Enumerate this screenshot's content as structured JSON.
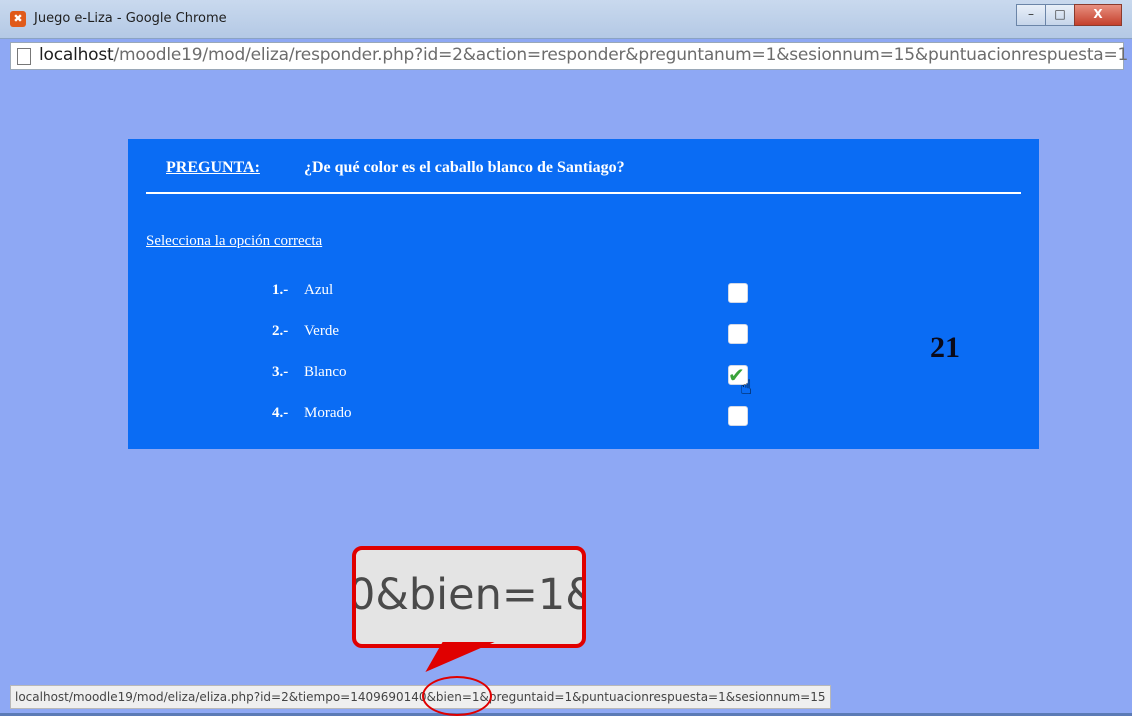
{
  "window": {
    "title": "Juego e-Liza - Google Chrome",
    "controls": {
      "minimize": "–",
      "maximize": "□",
      "close": "X"
    }
  },
  "address": {
    "host": "localhost",
    "path": "/moodle19/mod/eliza/responder.php?id=2&action=responder&preguntanum=1&sesionnum=15&puntuacionrespuesta=1"
  },
  "quiz": {
    "question_label": "PREGUNTA:",
    "question_text": "¿De qué color es el caballo blanco de Santiago?",
    "instruction": "Selecciona la opción correcta",
    "options": [
      {
        "number": "1.-",
        "label": "Azul",
        "checked": false
      },
      {
        "number": "2.-",
        "label": "Verde",
        "checked": false
      },
      {
        "number": "3.-",
        "label": "Blanco",
        "checked": true
      },
      {
        "number": "4.-",
        "label": "Morado",
        "checked": false
      }
    ],
    "score": "21"
  },
  "callout": {
    "zoom_text": "0&bien=1&"
  },
  "status_bar": {
    "url": "localhost/moodle19/mod/eliza/eliza.php?id=2&tiempo=1409690140&bien=1&preguntaid=1&puntuacionrespuesta=1&sesionnum=15"
  },
  "colors": {
    "panel": "#0a6cf4",
    "page_bg": "#8ea8f4",
    "highlight": "#e00000",
    "check": "#3aa33a"
  },
  "icons": {
    "app": "eliza-app-icon",
    "page": "page-icon",
    "check": "checkmark-icon",
    "cursor": "hand-cursor-icon"
  }
}
